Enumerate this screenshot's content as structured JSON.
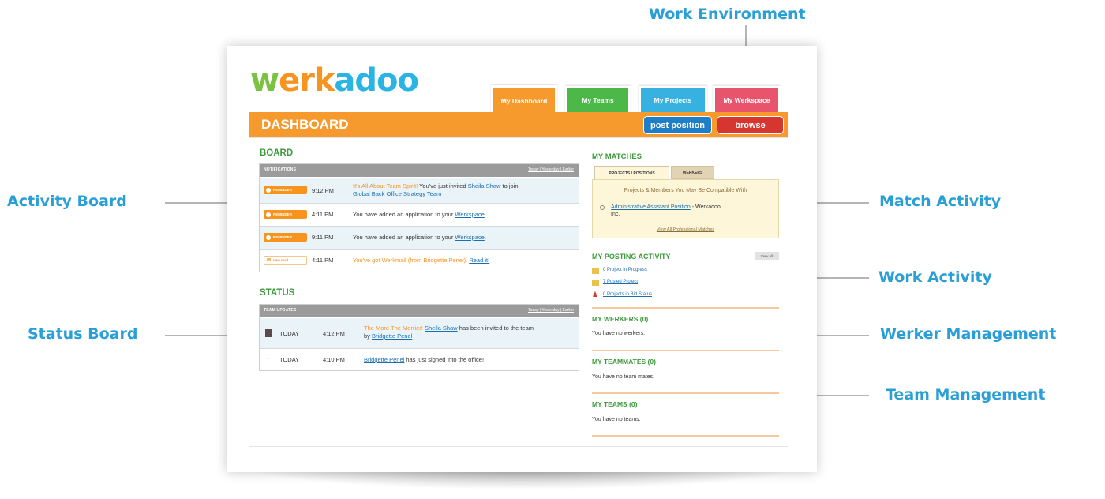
{
  "annotations": {
    "work_environment": "Work Environment",
    "activity_board": "Activity Board",
    "status_board": "Status Board",
    "match_activity": "Match Activity",
    "work_activity": "Work Activity",
    "werker_management": "Werker Management",
    "team_management": "Team Management"
  },
  "logo": {
    "part1": "w",
    "part2": "erk",
    "part3": "adoo"
  },
  "tabs": [
    {
      "label": "My Dashboard",
      "color": "#f79a2e"
    },
    {
      "label": "My Teams",
      "color": "#4cb848"
    },
    {
      "label": "My Projects",
      "color": "#37b2e0"
    },
    {
      "label": "My Werkspace",
      "color": "#e8546b"
    }
  ],
  "header": {
    "title": "DASHBOARD",
    "post_position": "post position",
    "browse": "browse"
  },
  "board": {
    "title": "BOARD",
    "panel_title": "NOTIFICATIONS",
    "links": "Today | Yesterday | Earlier",
    "rows": [
      {
        "badge": "REMINDER",
        "time": "9:12 PM",
        "lead": "It's All About Team Spirit!",
        "text1": " You've just invited ",
        "link1": "Sheila Shaw",
        "text2": " to join",
        "link2": "Global Back Office Strategy Team"
      },
      {
        "badge": "REMINDER",
        "time": "4:11 PM",
        "text1": "You have added an application to your ",
        "link1": "Werkspace",
        "text2": "."
      },
      {
        "badge": "REMINDER",
        "time": "9:11 PM",
        "text1": "You have added an application to your ",
        "link1": "Werkspace",
        "text2": "."
      },
      {
        "badge": "new mail",
        "time": "4:11 PM",
        "lead": "You've got Werkmail (from Bridgette Penel).",
        "link1": "Read it!"
      }
    ]
  },
  "status": {
    "title": "STATUS",
    "panel_title": "TEAM UPDATES",
    "links": "Today | Yesterday | Earlier",
    "rows": [
      {
        "day": "TODAY",
        "time": "4:12 PM",
        "lead": "The More The Merrier!",
        "link1": "Sheila Shaw",
        "text1": " has been invited to the team",
        "text2": "by ",
        "link2": "Bridgette Penel"
      },
      {
        "day": "TODAY",
        "time": "4:10 PM",
        "link1": "Bridgette Penel",
        "text1": " has just signed into the office!"
      }
    ]
  },
  "matches": {
    "title": "MY MATCHES",
    "tab1": "PROJECTS / POSITIONS",
    "tab2": "WERKERS",
    "headline": "Projects & Members You May Be Compatible With",
    "item_link": "Administrative Assistant Position",
    "item_suffix": " - Werkadoo,",
    "item_suffix2": "Inc.",
    "view_all": "View All Professional Matches"
  },
  "posting": {
    "title": "MY POSTING ACTIVITY",
    "view_all": "View All",
    "items": [
      "0 Project in Progress",
      "7 Posted Project",
      "0 Projects in Bid Status"
    ]
  },
  "werkers": {
    "title": "MY WERKERS (0)",
    "empty": "You have no werkers."
  },
  "teammates": {
    "title": "MY TEAMMATES (0)",
    "empty": "You have no team mates."
  },
  "teams": {
    "title": "MY TEAMS (0)",
    "empty": "You have no teams."
  }
}
